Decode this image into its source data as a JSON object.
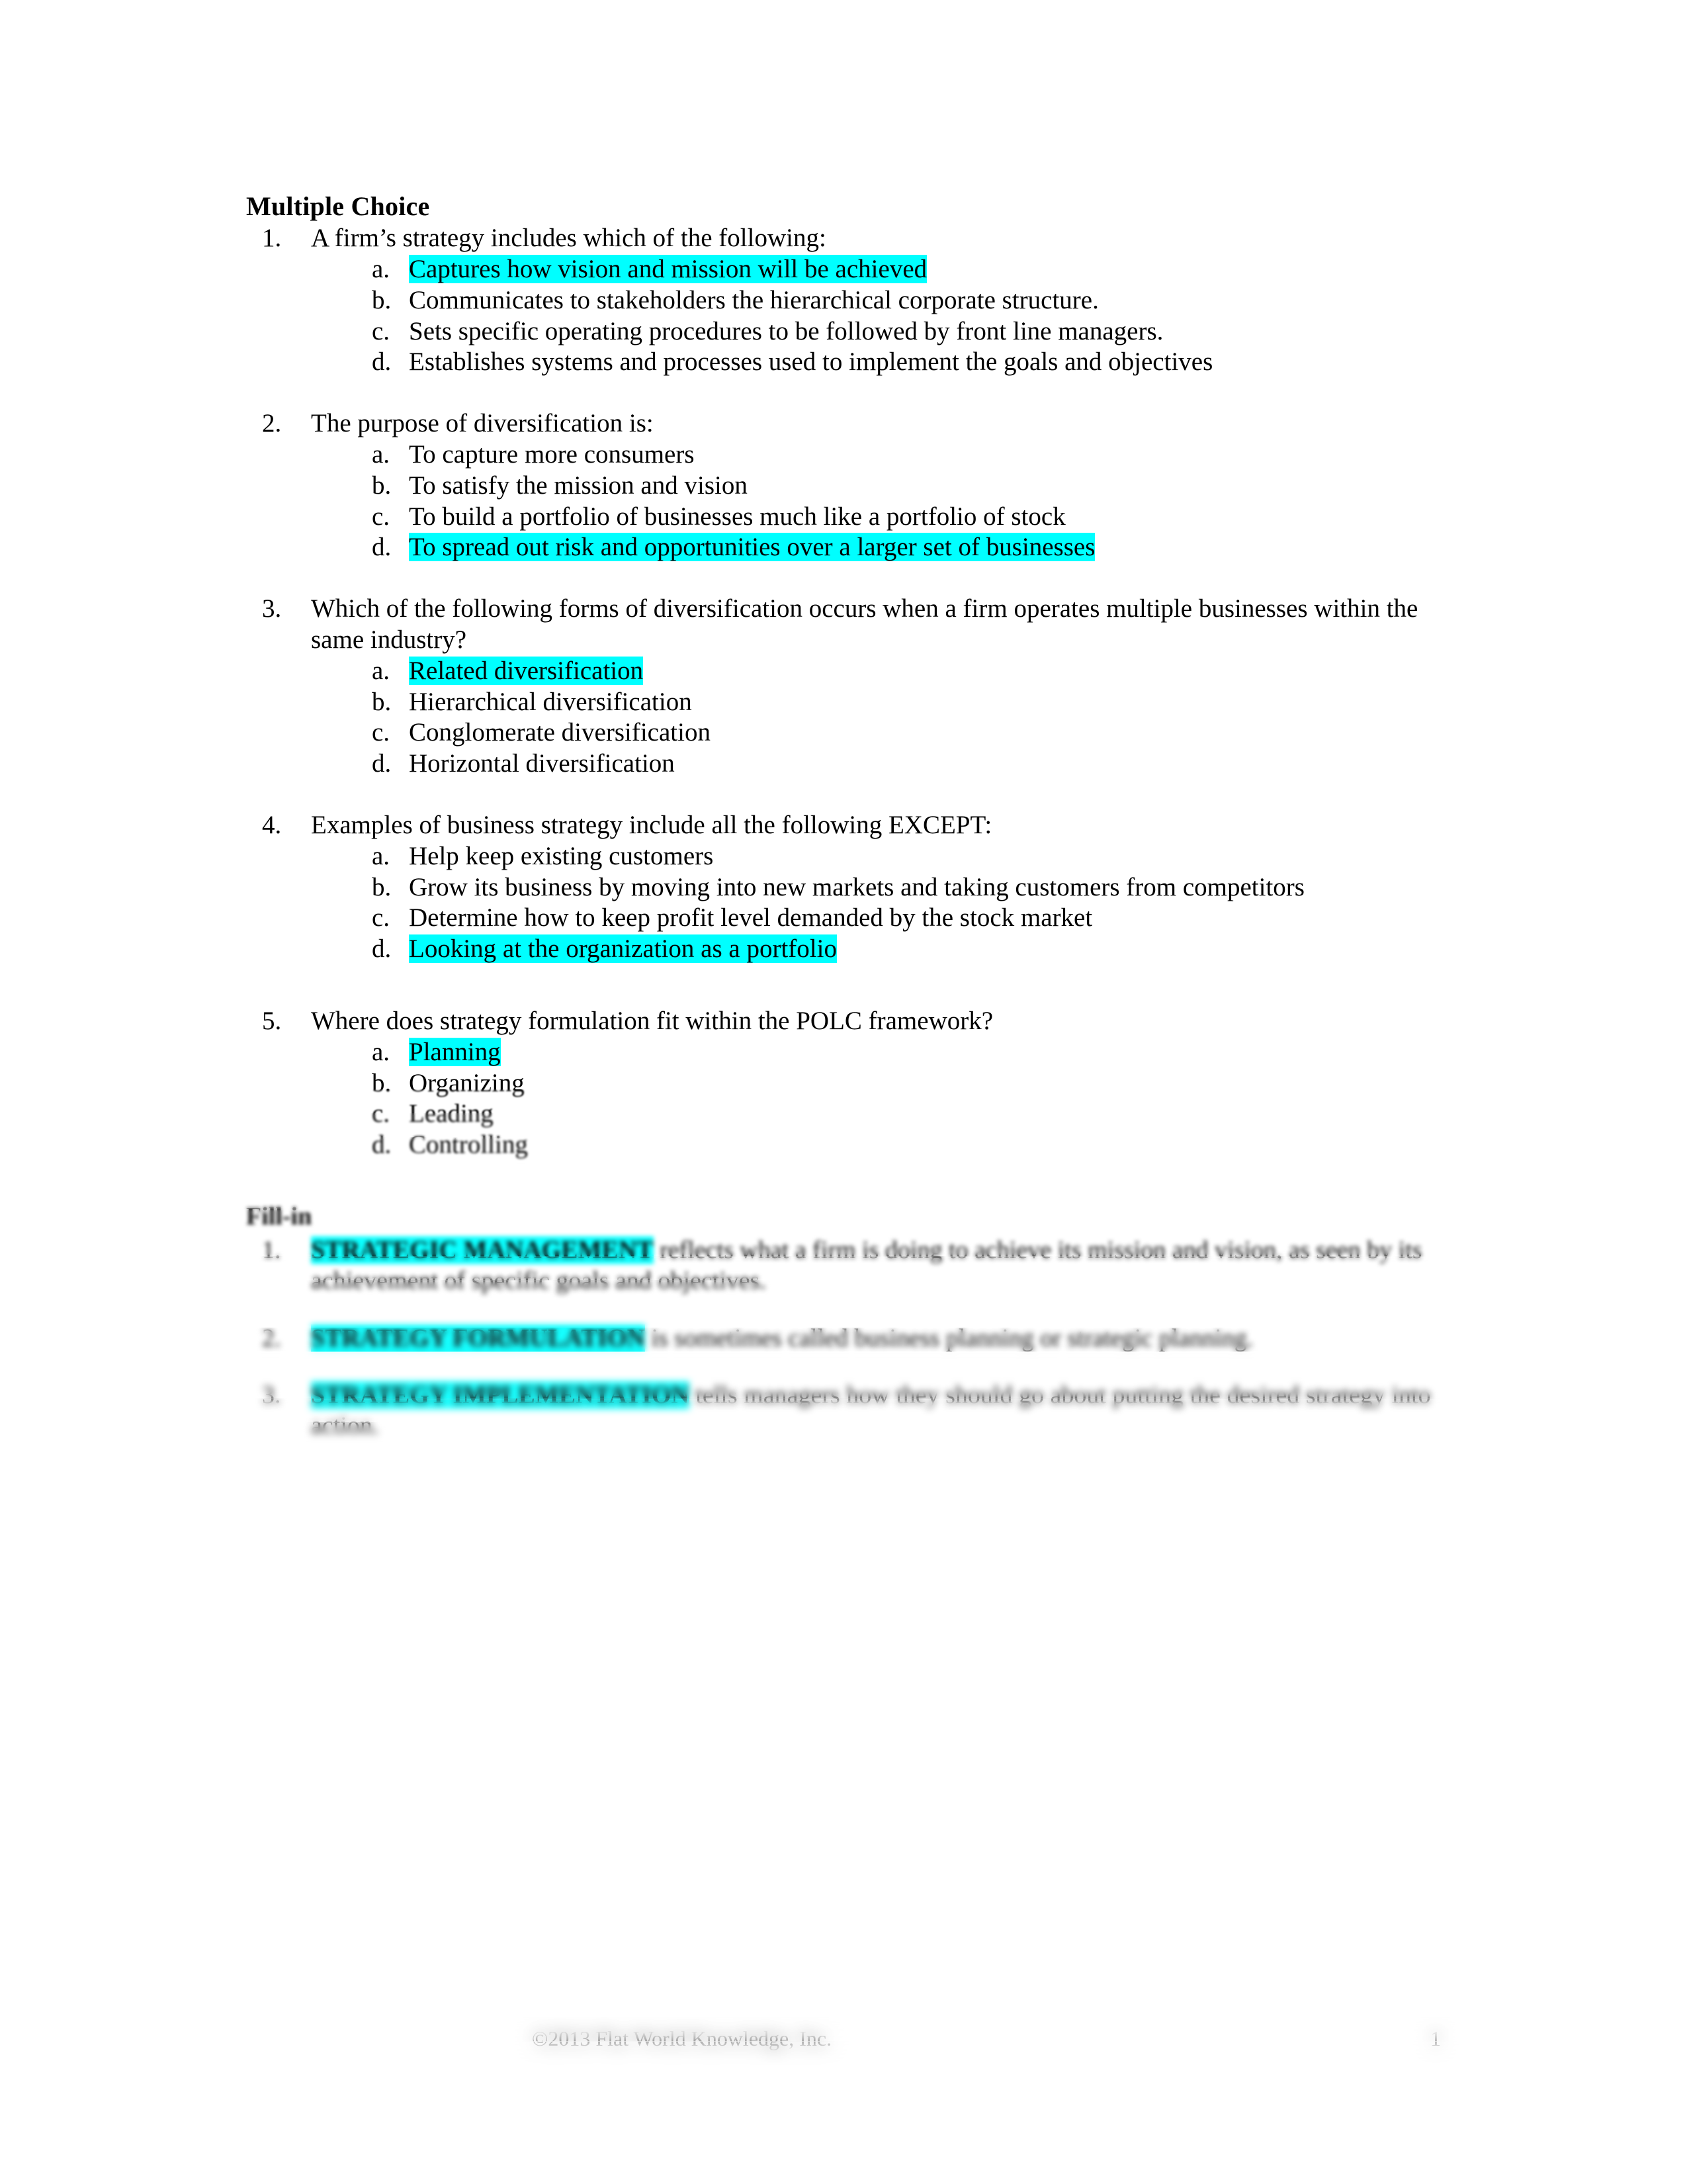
{
  "document": {
    "sections": [
      {
        "id": "multiple-choice",
        "title": "Multiple Choice",
        "questions": [
          {
            "number": "1.",
            "stem": "A firm’s strategy includes which of the following:",
            "options": [
              {
                "letter": "a.",
                "text": "Captures how vision and mission will be achieved",
                "highlighted": true
              },
              {
                "letter": "b.",
                "text": "Communicates to stakeholders the hierarchical corporate structure.",
                "highlighted": false
              },
              {
                "letter": "c.",
                "text": "Sets specific operating procedures to be followed by front line managers.",
                "highlighted": false
              },
              {
                "letter": "d.",
                "text": "Establishes systems and processes used to implement the goals and objectives",
                "highlighted": false
              }
            ]
          },
          {
            "number": "2.",
            "stem": "The purpose of diversification is:",
            "options": [
              {
                "letter": "a.",
                "text": "To capture more consumers",
                "highlighted": false
              },
              {
                "letter": "b.",
                "text": "To satisfy the mission and vision",
                "highlighted": false
              },
              {
                "letter": "c.",
                "text": "To build a portfolio of businesses much like a portfolio of stock",
                "highlighted": false
              },
              {
                "letter": "d.",
                "text": "To spread out risk and opportunities over a larger set of businesses",
                "highlighted": true
              }
            ]
          },
          {
            "number": "3.",
            "stem": "Which of the following forms of diversification occurs when a firm operates multiple businesses within the same industry?",
            "options": [
              {
                "letter": "a.",
                "text": "Related diversification",
                "highlighted": true
              },
              {
                "letter": "b.",
                "text": "Hierarchical diversification",
                "highlighted": false
              },
              {
                "letter": "c.",
                "text": "Conglomerate diversification",
                "highlighted": false
              },
              {
                "letter": "d.",
                "text": "Horizontal diversification",
                "highlighted": false
              }
            ]
          },
          {
            "number": "4.",
            "stem": "Examples of business strategy include all the following EXCEPT:",
            "options": [
              {
                "letter": "a.",
                "text": "Help keep existing customers",
                "highlighted": false
              },
              {
                "letter": "b.",
                "text": "Grow its business by moving into new markets and taking customers from competitors",
                "highlighted": false
              },
              {
                "letter": "c.",
                "text": "Determine how to keep profit level demanded by the stock market",
                "highlighted": false
              },
              {
                "letter": "d.",
                "text": "Looking at the organization as a portfolio",
                "highlighted": true
              }
            ]
          },
          {
            "number": "5.",
            "stem": "Where does strategy formulation fit within the POLC framework?",
            "options": [
              {
                "letter": "a.",
                "text": "Planning",
                "highlighted": true
              },
              {
                "letter": "b.",
                "text": "Organizing",
                "highlighted": false
              },
              {
                "letter": "c.",
                "text": "Leading",
                "highlighted": false
              },
              {
                "letter": "d.",
                "text": "Controlling",
                "highlighted": false
              }
            ]
          }
        ]
      },
      {
        "id": "fill-in",
        "title": "Fill-in",
        "items": [
          {
            "number": "1.",
            "answer": "STRATEGIC MANAGEMENT",
            "rest": " reflects what a firm is doing to achieve its mission and vision, as seen by its achievement of specific goals and objectives."
          },
          {
            "number": "2.",
            "answer": "STRATEGY FORMULATION",
            "rest": " is sometimes called business planning or strategic planning."
          },
          {
            "number": "3.",
            "answer": "STRATEGY IMPLEMENTATION",
            "rest": " tells managers how they should go about putting the desired strategy into action."
          }
        ]
      }
    ]
  },
  "footer": {
    "copyright": "©2013 Flat World Knowledge, Inc.",
    "page_number": "1"
  },
  "style": {
    "highlight_color": "#00FFFF",
    "text_color": "#000000",
    "page_background": "#FFFFFF"
  }
}
